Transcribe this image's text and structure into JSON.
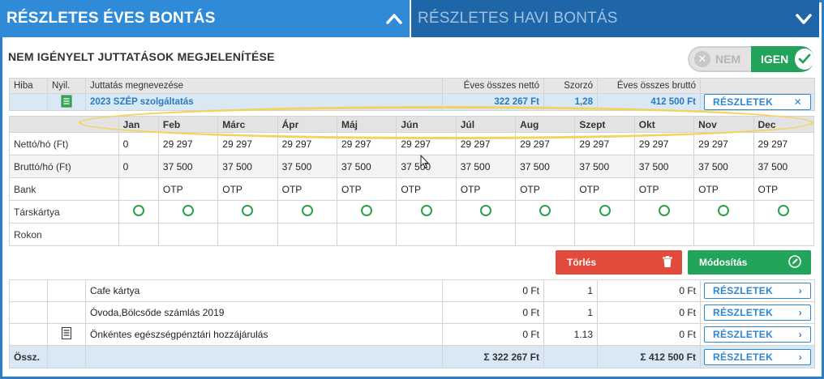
{
  "tabs": {
    "yearly": "RÉSZLETES ÉVES BONTÁS",
    "monthly": "RÉSZLETES HAVI BONTÁS"
  },
  "section_title": "NEM IGÉNYELT JUTTATÁSOK MEGJELENÍTÉSE",
  "toggle": {
    "no": "NEM",
    "yes": "IGEN",
    "selected": "IGEN"
  },
  "main_table": {
    "headers": [
      "Hiba",
      "Nyil.",
      "Juttatás megnevezése",
      "Éves összes nettó",
      "Szorzó",
      "Éves összes bruttó",
      ""
    ],
    "selected_row": {
      "name": "2023 SZÉP szolgáltatás",
      "net": "322 267 Ft",
      "multiplier": "1,28",
      "gross": "412 500 Ft",
      "button": "RÉSZLETEK"
    }
  },
  "monthly": {
    "months": [
      "Jan",
      "Feb",
      "Márc",
      "Ápr",
      "Máj",
      "Jún",
      "Júl",
      "Aug",
      "Szept",
      "Okt",
      "Nov",
      "Dec"
    ],
    "rows": {
      "net_label": "Nettó/hó (Ft)",
      "net": [
        "0",
        "29 297",
        "29 297",
        "29 297",
        "29 297",
        "29 297",
        "29 297",
        "29 297",
        "29 297",
        "29 297",
        "29 297",
        "29 297"
      ],
      "gross_label": "Bruttó/hó (Ft)",
      "gross": [
        "0",
        "37 500",
        "37 500",
        "37 500",
        "37 500",
        "37 500",
        "37 500",
        "37 500",
        "37 500",
        "37 500",
        "37 500",
        "37 500"
      ],
      "bank_label": "Bank",
      "bank": [
        "",
        "OTP",
        "OTP",
        "OTP",
        "OTP",
        "OTP",
        "OTP",
        "OTP",
        "OTP",
        "OTP",
        "OTP",
        "OTP"
      ],
      "card_label": "Társkártya",
      "relative_label": "Rokon"
    }
  },
  "actions": {
    "delete": "Törlés",
    "modify": "Módosítás"
  },
  "list": [
    {
      "name": "Cafe kártya",
      "net": "0 Ft",
      "multiplier": "1",
      "gross": "0 Ft",
      "button": "RÉSZLETEK",
      "doc": false
    },
    {
      "name": "Óvoda,Bölcsőde számlás 2019",
      "net": "0 Ft",
      "multiplier": "1",
      "gross": "0 Ft",
      "button": "RÉSZLETEK",
      "doc": false
    },
    {
      "name": "Önkéntes egészségpénztári hozzájárulás",
      "net": "0 Ft",
      "multiplier": "1.13",
      "gross": "0 Ft",
      "button": "RÉSZLETEK",
      "doc": true
    }
  ],
  "sum_row": {
    "label": "Össz.",
    "net": "Σ 322 267 Ft",
    "gross": "Σ 412 500 Ft",
    "button": "RÉSZLETEK"
  },
  "colors": {
    "accent": "#2f8bd8",
    "green": "#22a55a",
    "red": "#e24a3c",
    "highlight": "#f3d25e"
  }
}
